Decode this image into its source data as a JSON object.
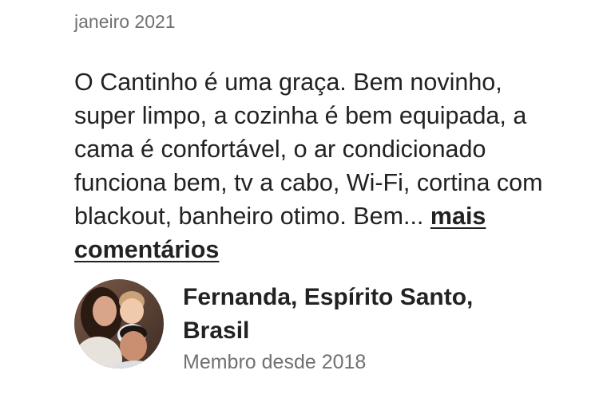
{
  "review": {
    "date": "janeiro 2021",
    "comment_text": "O Cantinho é uma graça. Bem novinho, super limpo, a cozinha é bem equipada, a cama é confortável, o ar condicionado funciona bem, tv a cabo, Wi-Fi, cortina com blackout, banheiro otimo. Bem... ",
    "more_link_label": "mais comentários"
  },
  "author": {
    "name": "Fernanda, Espírito Santo, Brasil",
    "member_since": "Membro desde 2018",
    "avatar_icon": "user-photo-avatar"
  }
}
